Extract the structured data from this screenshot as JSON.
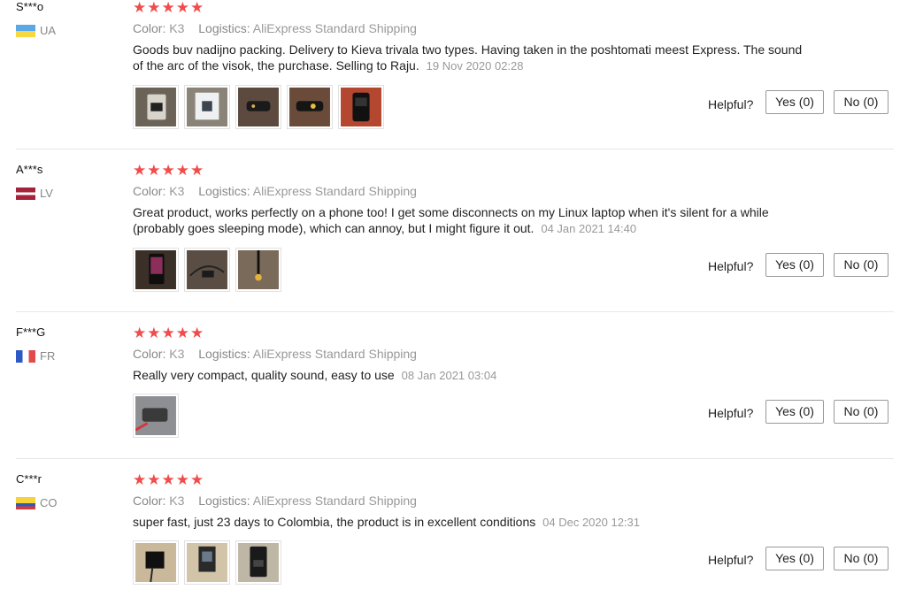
{
  "labels": {
    "color_key": "Color:",
    "logistics_key": "Logistics:",
    "helpful": "Helpful?",
    "star_glyph": "★"
  },
  "reviews": [
    {
      "user": "S***o",
      "country": "UA",
      "rating": 5,
      "color": "K3",
      "logistics": "AliExpress Standard Shipping",
      "text": "Goods buv nadijno packing. Delivery to Kieva trivala two types. Having taken in the poshtomati meest Express. The sound of the arc of the visok, the purchase. Selling to Raju.",
      "date": "19 Nov 2020 02:28",
      "photo_count": 5,
      "yes_label": "Yes (0)",
      "no_label": "No (0)"
    },
    {
      "user": "A***s",
      "country": "LV",
      "rating": 5,
      "color": "K3",
      "logistics": "AliExpress Standard Shipping",
      "text": "Great product, works perfectly on a phone too! I get some disconnects on my Linux laptop when it's silent for a while (probably goes sleeping mode), which can annoy, but I might figure it out.",
      "date": "04 Jan 2021 14:40",
      "photo_count": 3,
      "yes_label": "Yes (0)",
      "no_label": "No (0)"
    },
    {
      "user": "F***G",
      "country": "FR",
      "rating": 5,
      "color": "K3",
      "logistics": "AliExpress Standard Shipping",
      "text": "Really very compact, quality sound, easy to use",
      "date": "08 Jan 2021 03:04",
      "photo_count": 1,
      "yes_label": "Yes (0)",
      "no_label": "No (0)"
    },
    {
      "user": "C***r",
      "country": "CO",
      "rating": 5,
      "color": "K3",
      "logistics": "AliExpress Standard Shipping",
      "text": "super fast, just 23 days to Colombia, the product is in excellent conditions",
      "date": "04 Dec 2020 12:31",
      "photo_count": 3,
      "yes_label": "Yes (0)",
      "no_label": "No (0)"
    }
  ]
}
